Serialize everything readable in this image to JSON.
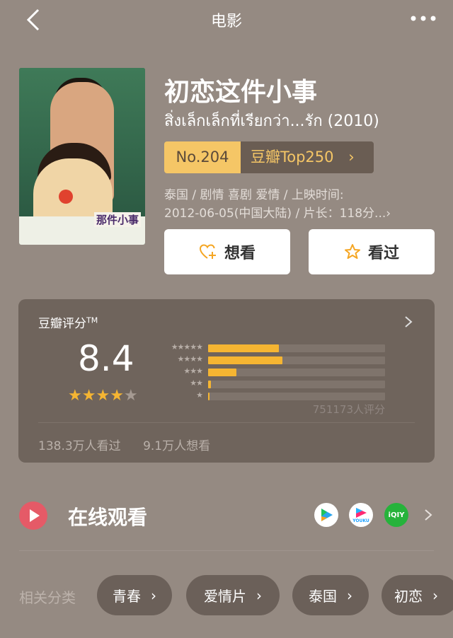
{
  "header": {
    "title": "电影"
  },
  "movie": {
    "title": "初恋这件小事",
    "original_title": "สิ่งเล็กเล็กที่เรียกว่า...รัก (2010)",
    "rank_number": "No.204",
    "rank_list": "豆瓣Top250",
    "meta_line1": "泰国 / 剧情 喜剧 爱情 / 上映时间:",
    "meta_line2": "2012-06-05(中国大陆) / 片长：118分...",
    "poster_title": "那件小事",
    "actions": {
      "want": "想看",
      "seen": "看过"
    }
  },
  "rating": {
    "label": "豆瓣评分",
    "tm": "TM",
    "score": "8.4",
    "stars": 4,
    "distribution": [
      {
        "stars": 5,
        "fraction": 0.4
      },
      {
        "stars": 4,
        "fraction": 0.42
      },
      {
        "stars": 3,
        "fraction": 0.16
      },
      {
        "stars": 2,
        "fraction": 0.015
      },
      {
        "stars": 1,
        "fraction": 0.006
      }
    ],
    "count": "751173人评分",
    "seen_count": "138.3万人看过",
    "want_count": "9.1万人想看"
  },
  "watch": {
    "label": "在线观看",
    "providers": [
      {
        "name": "tencent-video-icon",
        "text": ""
      },
      {
        "name": "youku-icon",
        "text": "YOUKU"
      },
      {
        "name": "iqiyi-icon",
        "text": "iQIY"
      }
    ]
  },
  "categories": {
    "label": "相关分类",
    "items": [
      "青春",
      "爱情片",
      "泰国",
      "初恋"
    ]
  },
  "colors": {
    "background": "#958a82",
    "accent": "#f5b532",
    "rank_bg": "#f5c666"
  }
}
